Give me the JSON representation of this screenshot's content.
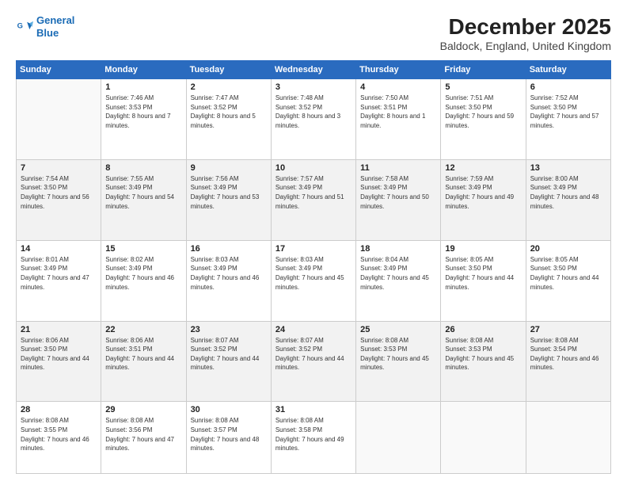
{
  "header": {
    "logo_line1": "General",
    "logo_line2": "Blue",
    "title": "December 2025",
    "subtitle": "Baldock, England, United Kingdom"
  },
  "weekdays": [
    "Sunday",
    "Monday",
    "Tuesday",
    "Wednesday",
    "Thursday",
    "Friday",
    "Saturday"
  ],
  "weeks": [
    [
      {
        "day": "",
        "sunrise": "",
        "sunset": "",
        "daylight": ""
      },
      {
        "day": "1",
        "sunrise": "Sunrise: 7:46 AM",
        "sunset": "Sunset: 3:53 PM",
        "daylight": "Daylight: 8 hours and 7 minutes."
      },
      {
        "day": "2",
        "sunrise": "Sunrise: 7:47 AM",
        "sunset": "Sunset: 3:52 PM",
        "daylight": "Daylight: 8 hours and 5 minutes."
      },
      {
        "day": "3",
        "sunrise": "Sunrise: 7:48 AM",
        "sunset": "Sunset: 3:52 PM",
        "daylight": "Daylight: 8 hours and 3 minutes."
      },
      {
        "day": "4",
        "sunrise": "Sunrise: 7:50 AM",
        "sunset": "Sunset: 3:51 PM",
        "daylight": "Daylight: 8 hours and 1 minute."
      },
      {
        "day": "5",
        "sunrise": "Sunrise: 7:51 AM",
        "sunset": "Sunset: 3:50 PM",
        "daylight": "Daylight: 7 hours and 59 minutes."
      },
      {
        "day": "6",
        "sunrise": "Sunrise: 7:52 AM",
        "sunset": "Sunset: 3:50 PM",
        "daylight": "Daylight: 7 hours and 57 minutes."
      }
    ],
    [
      {
        "day": "7",
        "sunrise": "Sunrise: 7:54 AM",
        "sunset": "Sunset: 3:50 PM",
        "daylight": "Daylight: 7 hours and 56 minutes."
      },
      {
        "day": "8",
        "sunrise": "Sunrise: 7:55 AM",
        "sunset": "Sunset: 3:49 PM",
        "daylight": "Daylight: 7 hours and 54 minutes."
      },
      {
        "day": "9",
        "sunrise": "Sunrise: 7:56 AM",
        "sunset": "Sunset: 3:49 PM",
        "daylight": "Daylight: 7 hours and 53 minutes."
      },
      {
        "day": "10",
        "sunrise": "Sunrise: 7:57 AM",
        "sunset": "Sunset: 3:49 PM",
        "daylight": "Daylight: 7 hours and 51 minutes."
      },
      {
        "day": "11",
        "sunrise": "Sunrise: 7:58 AM",
        "sunset": "Sunset: 3:49 PM",
        "daylight": "Daylight: 7 hours and 50 minutes."
      },
      {
        "day": "12",
        "sunrise": "Sunrise: 7:59 AM",
        "sunset": "Sunset: 3:49 PM",
        "daylight": "Daylight: 7 hours and 49 minutes."
      },
      {
        "day": "13",
        "sunrise": "Sunrise: 8:00 AM",
        "sunset": "Sunset: 3:49 PM",
        "daylight": "Daylight: 7 hours and 48 minutes."
      }
    ],
    [
      {
        "day": "14",
        "sunrise": "Sunrise: 8:01 AM",
        "sunset": "Sunset: 3:49 PM",
        "daylight": "Daylight: 7 hours and 47 minutes."
      },
      {
        "day": "15",
        "sunrise": "Sunrise: 8:02 AM",
        "sunset": "Sunset: 3:49 PM",
        "daylight": "Daylight: 7 hours and 46 minutes."
      },
      {
        "day": "16",
        "sunrise": "Sunrise: 8:03 AM",
        "sunset": "Sunset: 3:49 PM",
        "daylight": "Daylight: 7 hours and 46 minutes."
      },
      {
        "day": "17",
        "sunrise": "Sunrise: 8:03 AM",
        "sunset": "Sunset: 3:49 PM",
        "daylight": "Daylight: 7 hours and 45 minutes."
      },
      {
        "day": "18",
        "sunrise": "Sunrise: 8:04 AM",
        "sunset": "Sunset: 3:49 PM",
        "daylight": "Daylight: 7 hours and 45 minutes."
      },
      {
        "day": "19",
        "sunrise": "Sunrise: 8:05 AM",
        "sunset": "Sunset: 3:50 PM",
        "daylight": "Daylight: 7 hours and 44 minutes."
      },
      {
        "day": "20",
        "sunrise": "Sunrise: 8:05 AM",
        "sunset": "Sunset: 3:50 PM",
        "daylight": "Daylight: 7 hours and 44 minutes."
      }
    ],
    [
      {
        "day": "21",
        "sunrise": "Sunrise: 8:06 AM",
        "sunset": "Sunset: 3:50 PM",
        "daylight": "Daylight: 7 hours and 44 minutes."
      },
      {
        "day": "22",
        "sunrise": "Sunrise: 8:06 AM",
        "sunset": "Sunset: 3:51 PM",
        "daylight": "Daylight: 7 hours and 44 minutes."
      },
      {
        "day": "23",
        "sunrise": "Sunrise: 8:07 AM",
        "sunset": "Sunset: 3:52 PM",
        "daylight": "Daylight: 7 hours and 44 minutes."
      },
      {
        "day": "24",
        "sunrise": "Sunrise: 8:07 AM",
        "sunset": "Sunset: 3:52 PM",
        "daylight": "Daylight: 7 hours and 44 minutes."
      },
      {
        "day": "25",
        "sunrise": "Sunrise: 8:08 AM",
        "sunset": "Sunset: 3:53 PM",
        "daylight": "Daylight: 7 hours and 45 minutes."
      },
      {
        "day": "26",
        "sunrise": "Sunrise: 8:08 AM",
        "sunset": "Sunset: 3:53 PM",
        "daylight": "Daylight: 7 hours and 45 minutes."
      },
      {
        "day": "27",
        "sunrise": "Sunrise: 8:08 AM",
        "sunset": "Sunset: 3:54 PM",
        "daylight": "Daylight: 7 hours and 46 minutes."
      }
    ],
    [
      {
        "day": "28",
        "sunrise": "Sunrise: 8:08 AM",
        "sunset": "Sunset: 3:55 PM",
        "daylight": "Daylight: 7 hours and 46 minutes."
      },
      {
        "day": "29",
        "sunrise": "Sunrise: 8:08 AM",
        "sunset": "Sunset: 3:56 PM",
        "daylight": "Daylight: 7 hours and 47 minutes."
      },
      {
        "day": "30",
        "sunrise": "Sunrise: 8:08 AM",
        "sunset": "Sunset: 3:57 PM",
        "daylight": "Daylight: 7 hours and 48 minutes."
      },
      {
        "day": "31",
        "sunrise": "Sunrise: 8:08 AM",
        "sunset": "Sunset: 3:58 PM",
        "daylight": "Daylight: 7 hours and 49 minutes."
      },
      {
        "day": "",
        "sunrise": "",
        "sunset": "",
        "daylight": ""
      },
      {
        "day": "",
        "sunrise": "",
        "sunset": "",
        "daylight": ""
      },
      {
        "day": "",
        "sunrise": "",
        "sunset": "",
        "daylight": ""
      }
    ]
  ]
}
